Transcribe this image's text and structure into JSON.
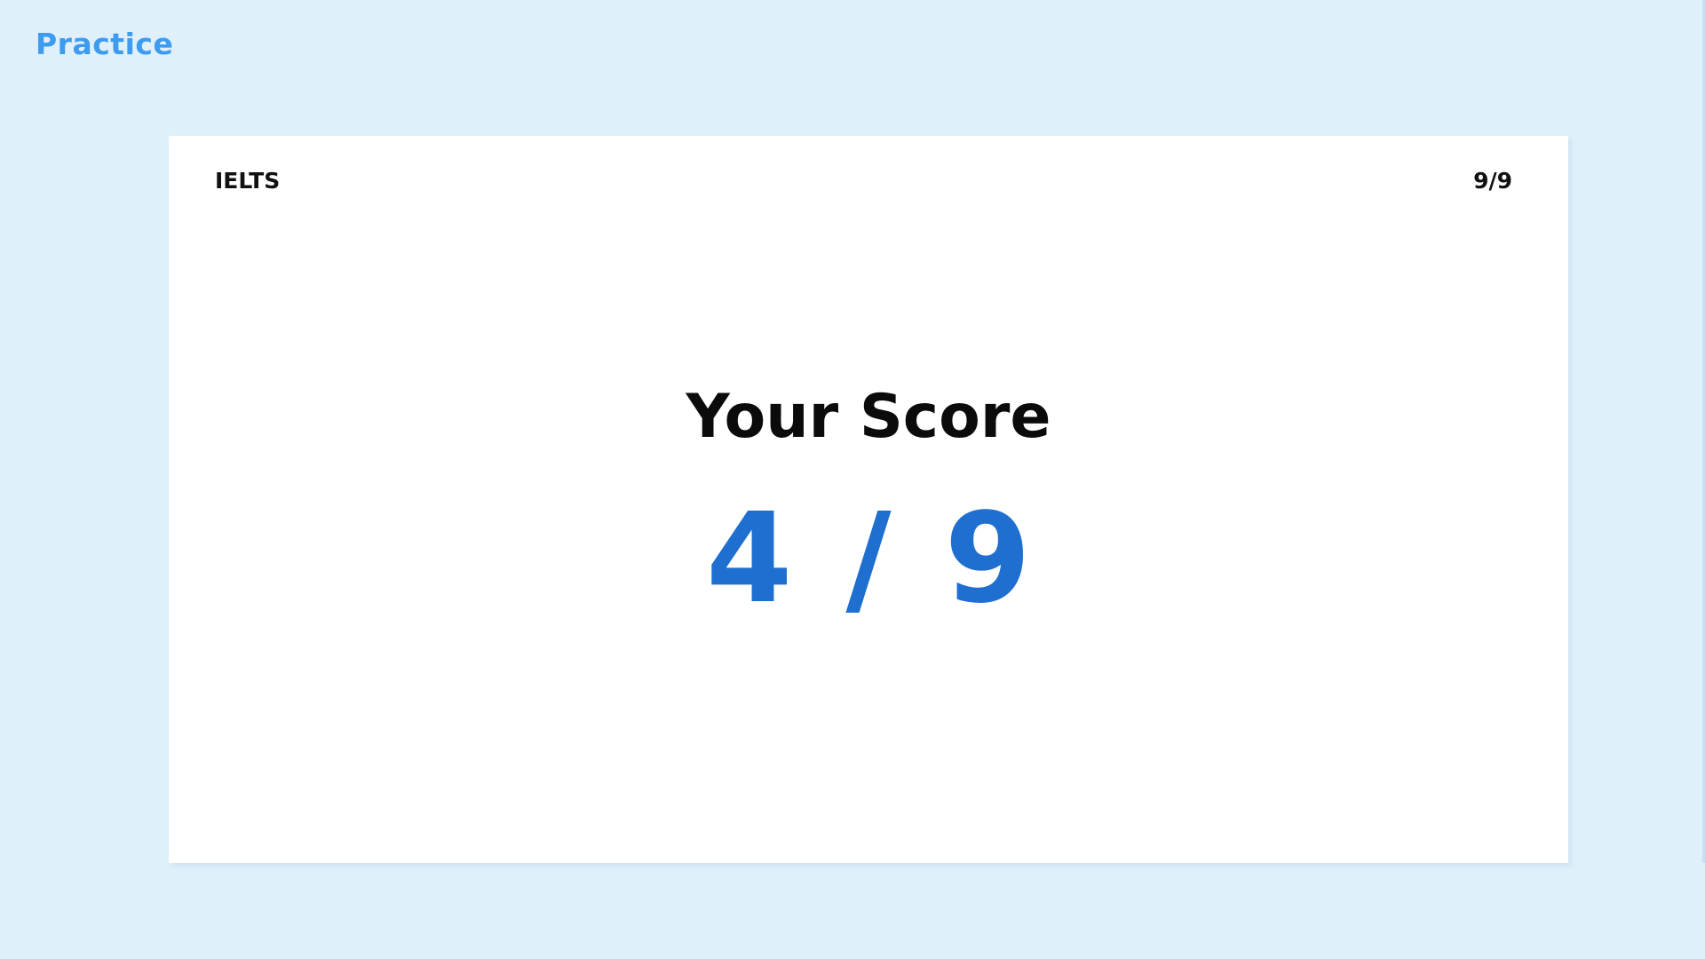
{
  "app": {
    "brand": "Practice"
  },
  "card": {
    "exam_name": "IELTS",
    "progress": "9/9",
    "heading": "Your Score",
    "score": {
      "correct": "4",
      "separator": "/",
      "total": "9"
    }
  },
  "colors": {
    "background": "#e0f0fb",
    "brand": "#3d9bf0",
    "score": "#1f6fd0",
    "card": "#ffffff",
    "text": "#111111"
  }
}
